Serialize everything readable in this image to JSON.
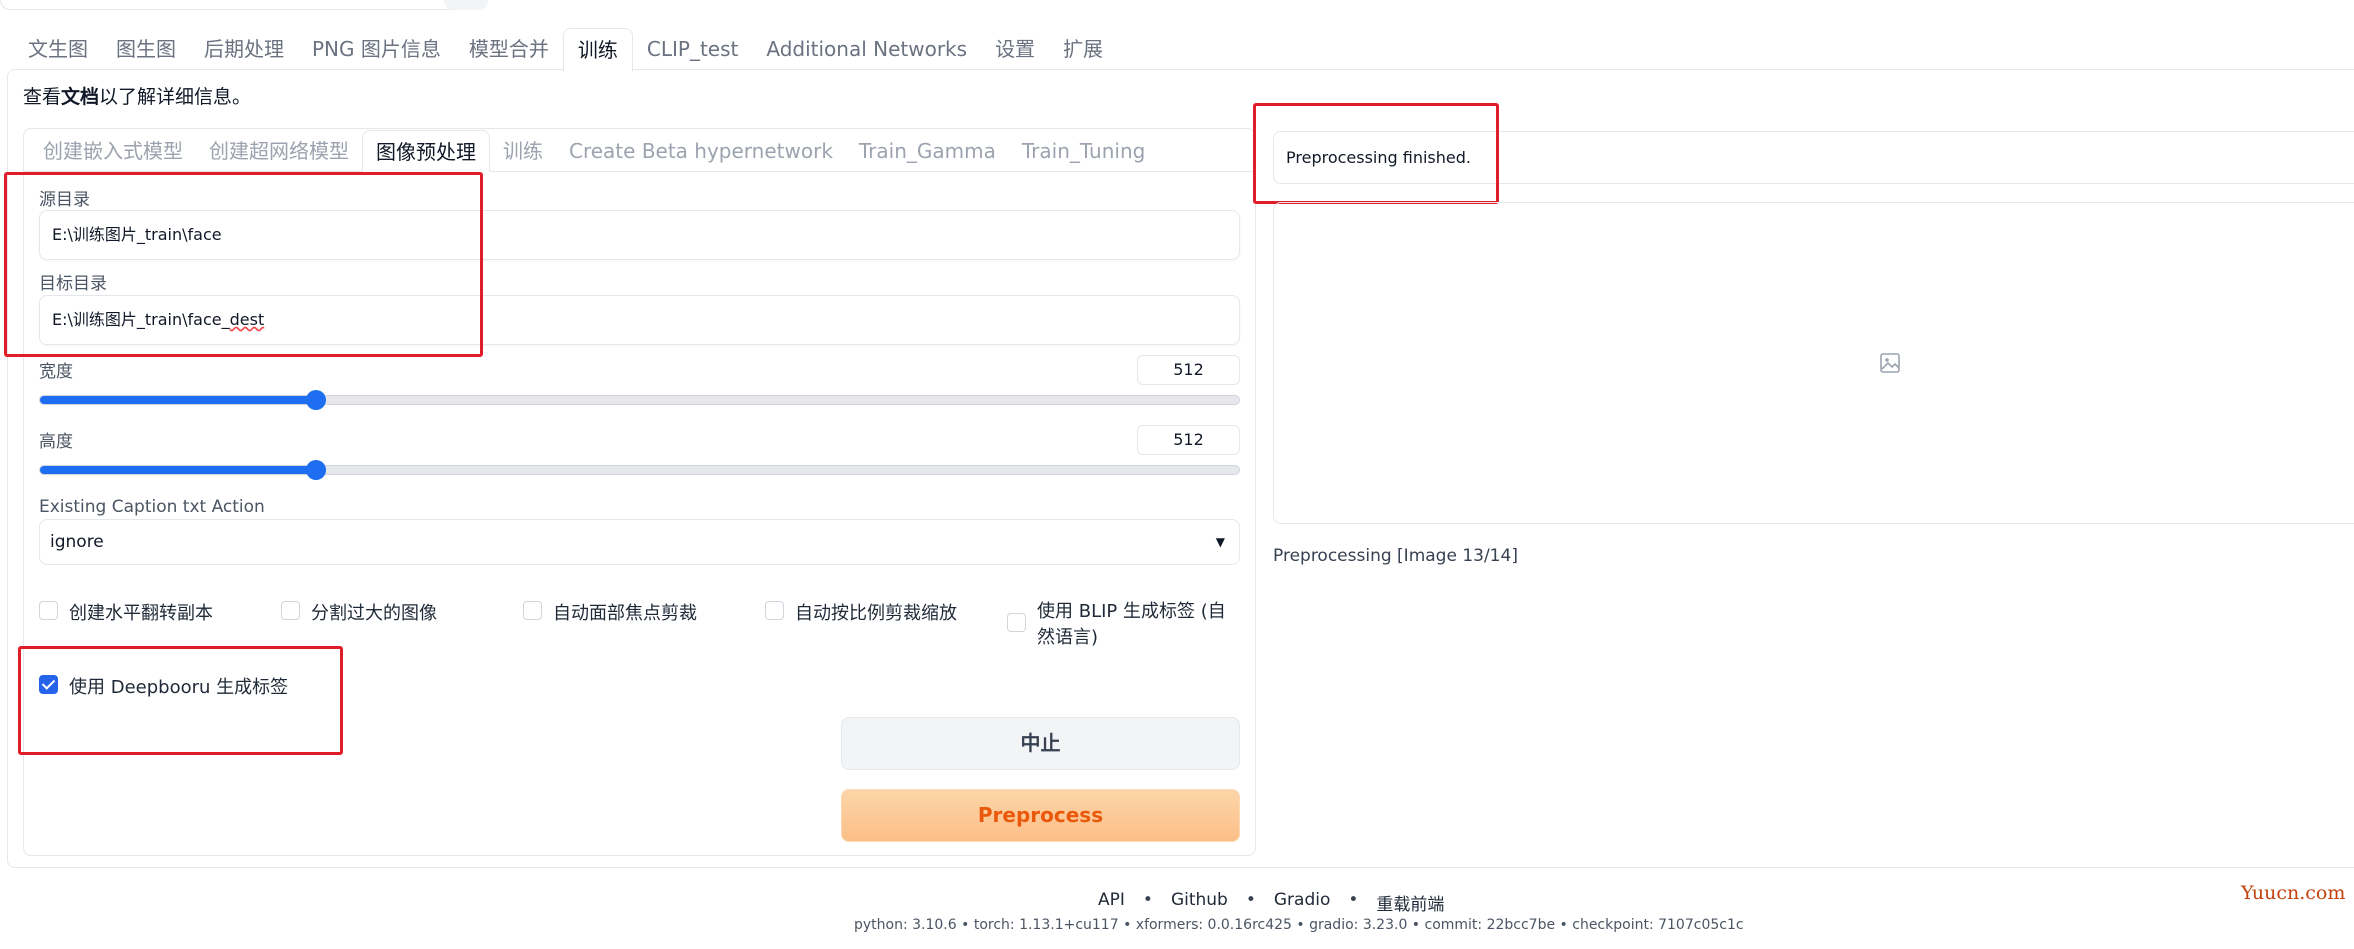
{
  "main_tabs": [
    "文生图",
    "图生图",
    "后期处理",
    "PNG 图片信息",
    "模型合并",
    "训练",
    "CLIP_test",
    "Additional Networks",
    "设置",
    "扩展"
  ],
  "main_tab_active": "训练",
  "note": {
    "prefix": "查看",
    "link": "文档",
    "suffix": "以了解详细信息。"
  },
  "sub_tabs": [
    "创建嵌入式模型",
    "创建超网络模型",
    "图像预处理",
    "训练",
    "Create Beta hypernetwork",
    "Train_Gamma",
    "Train_Tuning"
  ],
  "sub_tab_active": "图像预处理",
  "source_dir": {
    "label": "源目录",
    "value": "E:\\训练图片_train\\face"
  },
  "dest_dir": {
    "label": "目标目录",
    "value_prefix": "E:\\训练图片_train\\face_",
    "value_suffix": "dest"
  },
  "width": {
    "label": "宽度",
    "value": "512",
    "fraction": 0.23
  },
  "height": {
    "label": "高度",
    "value": "512",
    "fraction": 0.23
  },
  "caption_action": {
    "label": "Existing Caption txt Action",
    "value": "ignore"
  },
  "checkboxes": [
    {
      "label": "创建水平翻转副本",
      "checked": false
    },
    {
      "label": "分割过大的图像",
      "checked": false
    },
    {
      "label": "自动面部焦点剪裁",
      "checked": false
    },
    {
      "label": "自动按比例剪裁缩放",
      "checked": false
    },
    {
      "label": "使用 BLIP 生成标签 (自然语言)",
      "checked": false
    },
    {
      "label": "使用 Deepbooru 生成标签",
      "checked": true
    }
  ],
  "buttons": {
    "stop": "中止",
    "preprocess": "Preprocess"
  },
  "output": {
    "status": "Preprocessing finished.",
    "progress": "Preprocessing [Image 13/14]"
  },
  "footer": {
    "links": [
      "API",
      "Github",
      "Gradio",
      "重载前端"
    ],
    "separator": "•",
    "version": "python: 3.10.6  •  torch: 1.13.1+cu117  •  xformers: 0.0.16rc425  •  gradio: 3.23.0  •  commit: 22bcc7be  •  checkpoint: 7107c05c1c"
  },
  "watermark": "Yuucn.com",
  "colors": {
    "accent": "#1d6ef0",
    "annotation_red": "#e11d2a",
    "preprocess_text": "#ea580c"
  }
}
